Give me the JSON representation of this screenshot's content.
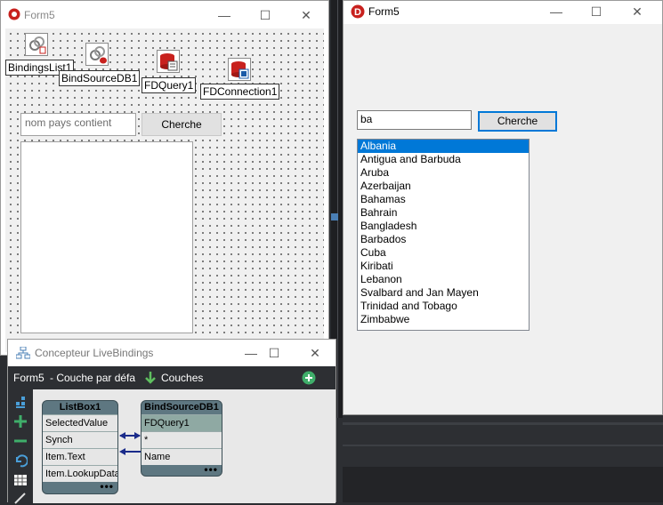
{
  "designer_form": {
    "title": "Form5",
    "components": {
      "bindingslist": "BindingsList1",
      "bindsource": "BindSourceDB1",
      "fdquery": "FDQuery1",
      "fdconnection": "FDConnection1"
    },
    "search_placeholder": "nom pays contient",
    "search_button": "Cherche"
  },
  "runtime_form": {
    "title": "Form5",
    "search_value": "ba",
    "search_button": "Cherche",
    "countries": [
      "Albania",
      "Antigua and Barbuda",
      "Aruba",
      "Azerbaijan",
      "Bahamas",
      "Bahrain",
      "Bangladesh",
      "Barbados",
      "Cuba",
      "Kiribati",
      "Lebanon",
      "Svalbard and Jan Mayen",
      "Trinidad and Tobago",
      "Zimbabwe"
    ],
    "selected_index": 0
  },
  "livebindings": {
    "title": "Concepteur LiveBindings",
    "form_label": "Form5",
    "layer_label": "- Couche par défa",
    "layers_label": "Couches",
    "listbox_node": {
      "title": "ListBox1",
      "rows": [
        "SelectedValue",
        "Synch",
        "Item.Text",
        "Item.LookupData"
      ]
    },
    "bindsource_node": {
      "title": "BindSourceDB1",
      "subtitle": "FDQuery1",
      "rows": [
        "*",
        "Name"
      ]
    }
  },
  "colors": {
    "selection": "#0078d7",
    "node_header": "#5e7781",
    "link": "#1a2b8a",
    "ide_dark": "#2d2f33"
  }
}
